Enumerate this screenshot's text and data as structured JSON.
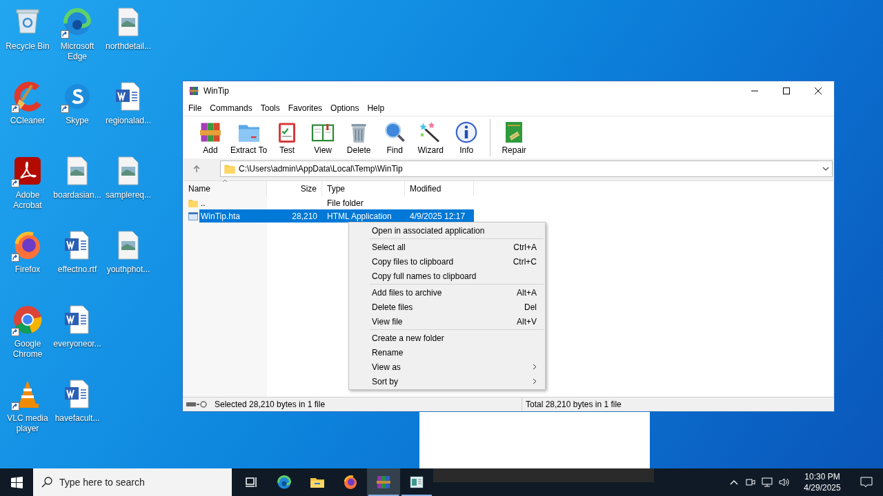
{
  "desktop_icons": [
    {
      "label": "Recycle Bin",
      "kind": "recycle",
      "shortcut": false
    },
    {
      "label": "Microsoft Edge",
      "kind": "edge",
      "shortcut": true
    },
    {
      "label": "northdetail...",
      "kind": "image",
      "shortcut": false
    },
    {
      "label": "CCleaner",
      "kind": "ccleaner",
      "shortcut": true
    },
    {
      "label": "Skype",
      "kind": "skype",
      "shortcut": true
    },
    {
      "label": "regionalad...",
      "kind": "word",
      "shortcut": false
    },
    {
      "label": "Adobe Acrobat",
      "kind": "acrobat",
      "shortcut": true
    },
    {
      "label": "boardasian...",
      "kind": "image",
      "shortcut": false
    },
    {
      "label": "samplereq...",
      "kind": "image",
      "shortcut": false
    },
    {
      "label": "Firefox",
      "kind": "firefox",
      "shortcut": true
    },
    {
      "label": "effectno.rtf",
      "kind": "word",
      "shortcut": false
    },
    {
      "label": "youthphot...",
      "kind": "image",
      "shortcut": false
    },
    {
      "label": "Google Chrome",
      "kind": "chrome",
      "shortcut": true
    },
    {
      "label": "everyoneor...",
      "kind": "word",
      "shortcut": false
    },
    {
      "label": "VLC media player",
      "kind": "vlc",
      "shortcut": true
    },
    {
      "label": "havefacult...",
      "kind": "word",
      "shortcut": false
    }
  ],
  "window": {
    "title": "WinTip",
    "menu": [
      "File",
      "Commands",
      "Tools",
      "Favorites",
      "Options",
      "Help"
    ],
    "toolbar": [
      {
        "label": "Add",
        "kind": "add"
      },
      {
        "label": "Extract To",
        "kind": "extract"
      },
      {
        "label": "Test",
        "kind": "test"
      },
      {
        "label": "View",
        "kind": "view"
      },
      {
        "label": "Delete",
        "kind": "delete"
      },
      {
        "label": "Find",
        "kind": "find"
      },
      {
        "label": "Wizard",
        "kind": "wizard"
      },
      {
        "label": "Info",
        "kind": "info"
      },
      {
        "label": "Repair",
        "kind": "repair"
      }
    ],
    "path": "C:\\Users\\admin\\AppData\\Local\\Temp\\WinTip",
    "columns": [
      "Name",
      "Size",
      "Type",
      "Modified"
    ],
    "rows": [
      {
        "name": "..",
        "size": "",
        "type": "File folder",
        "modified": "",
        "kind": "folder",
        "selected": false
      },
      {
        "name": "WinTip.hta",
        "size": "28,210",
        "type": "HTML Application",
        "modified": "4/9/2025 12:17",
        "kind": "hta",
        "selected": true
      }
    ],
    "status_left": "Selected 28,210 bytes in 1 file",
    "status_right": "Total 28,210 bytes in 1 file"
  },
  "context_menu": [
    [
      {
        "label": "Open in associated application"
      }
    ],
    [
      {
        "label": "Select all",
        "shortcut": "Ctrl+A"
      },
      {
        "label": "Copy files to clipboard",
        "shortcut": "Ctrl+C"
      },
      {
        "label": "Copy full names to clipboard"
      }
    ],
    [
      {
        "label": "Add files to archive",
        "shortcut": "Alt+A"
      },
      {
        "label": "Delete files",
        "shortcut": "Del"
      },
      {
        "label": "View file",
        "shortcut": "Alt+V"
      }
    ],
    [
      {
        "label": "Create a new folder"
      },
      {
        "label": "Rename"
      },
      {
        "label": "View as",
        "submenu": true
      },
      {
        "label": "Sort by",
        "submenu": true
      }
    ]
  ],
  "taskbar": {
    "search_placeholder": "Type here to search",
    "apps": [
      {
        "kind": "taskview",
        "open": false,
        "selected": false
      },
      {
        "kind": "edge",
        "open": false,
        "selected": false
      },
      {
        "kind": "explorer",
        "open": false,
        "selected": false
      },
      {
        "kind": "firefox",
        "open": false,
        "selected": false
      },
      {
        "kind": "winrar",
        "open": true,
        "selected": true
      },
      {
        "kind": "window",
        "open": true,
        "selected": false
      }
    ],
    "time": "10:30 PM",
    "date": "4/29/2025"
  }
}
